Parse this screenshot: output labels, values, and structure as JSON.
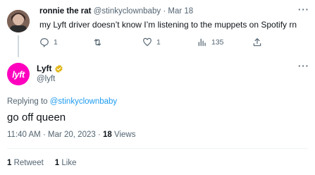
{
  "tweet1": {
    "display_name": "ronnie the rat",
    "handle": "@stinkyclownbaby",
    "separator": "·",
    "date": "Mar 18",
    "text": "my Lyft driver doesn’t know I’m listening to the muppets on Spotify rn",
    "replies": "1",
    "retweets": "",
    "likes": "1",
    "views": "135"
  },
  "tweet2": {
    "display_name": "Lyft",
    "handle": "@lyft",
    "avatar_word": "lyft",
    "brand_color": "#ff00bf",
    "verified_color": "#e2b719",
    "replying_prefix": "Replying to",
    "replying_to": "@stinkyclownbaby",
    "text": "go off queen",
    "time": "11:40 AM",
    "dot1": "·",
    "date": "Mar 20, 2023",
    "dot2": "·",
    "views_count": "18",
    "views_label": "Views",
    "retweet_count": "1",
    "retweet_label": "Retweet",
    "like_count": "1",
    "like_label": "Like"
  },
  "icons": {
    "more": "more-icon",
    "reply": "reply-icon",
    "retweet": "retweet-icon",
    "like": "heart-icon",
    "views": "views-icon",
    "share": "share-icon",
    "verified": "verified-badge-icon"
  },
  "colors": {
    "muted": "#536471",
    "link": "#1d9bf0",
    "text": "#0f1419"
  }
}
